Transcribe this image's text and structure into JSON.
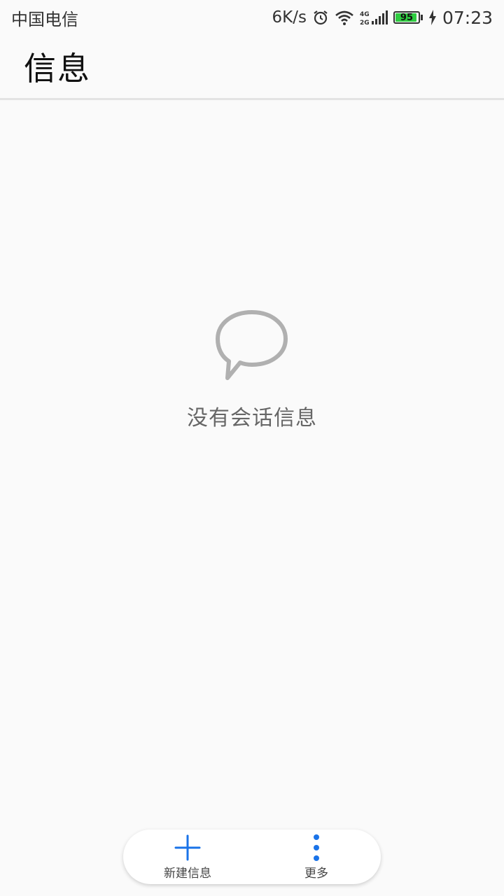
{
  "status_bar": {
    "carrier": "中国电信",
    "net_speed": "6K/s",
    "battery": "95",
    "time": "07:23",
    "icons": [
      "alarm-icon",
      "wifi-icon",
      "signal-4g-2g-icon",
      "battery-icon",
      "charging-icon"
    ],
    "network_types": [
      "4G",
      "2G"
    ]
  },
  "header": {
    "title": "信息"
  },
  "empty_state": {
    "icon": "chat-bubble-icon",
    "message": "没有会话信息"
  },
  "bottom_bar": {
    "new_message_label": "新建信息",
    "more_label": "更多"
  },
  "colors": {
    "accent": "#1a73e8",
    "battery_green": "#2ecc40",
    "background": "#fafafa"
  }
}
